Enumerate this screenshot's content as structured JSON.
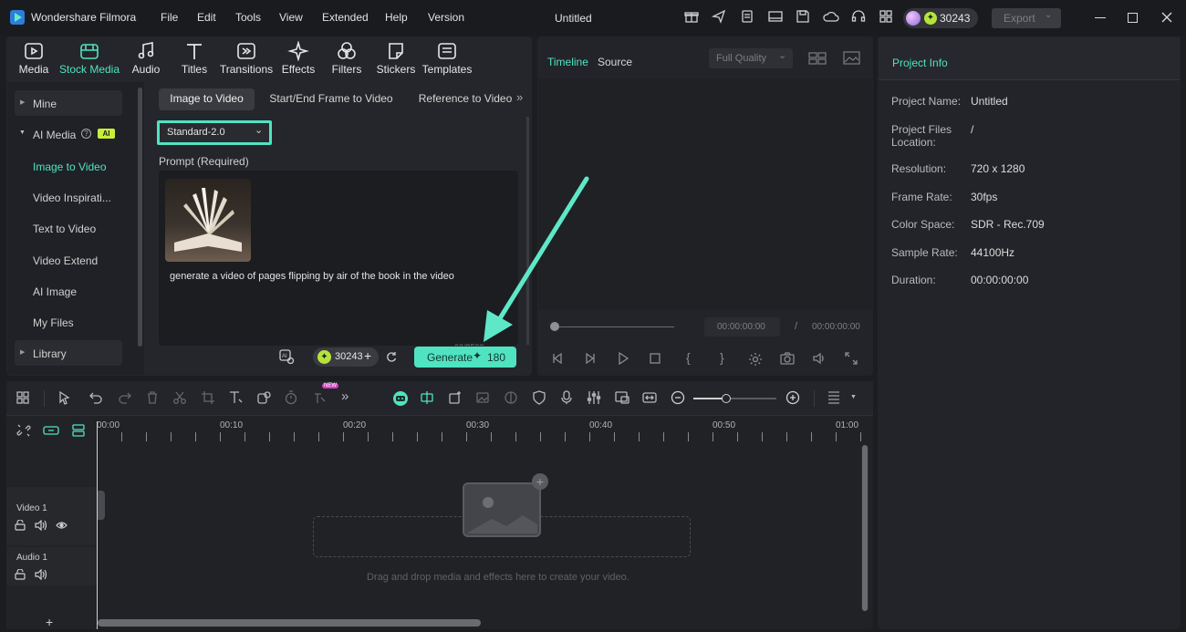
{
  "app": {
    "title": "Wondershare Filmora",
    "project_name": "Untitled"
  },
  "menu": [
    "File",
    "Edit",
    "Tools",
    "View",
    "Extended",
    "Help",
    "Version"
  ],
  "credits": "30243",
  "export_label": "Export",
  "toolbar_tabs": [
    "Media",
    "Stock Media",
    "Audio",
    "Titles",
    "Transitions",
    "Effects",
    "Filters",
    "Stickers",
    "Templates"
  ],
  "sidebar": {
    "mine": "Mine",
    "ai_media": "AI Media",
    "ai_badge": "AI",
    "items": [
      "Image to Video",
      "Video Inspirati...",
      "Text to Video",
      "Video Extend",
      "AI Image",
      "My Files"
    ],
    "library": "Library"
  },
  "subtabs": [
    "Image to Video",
    "Start/End Frame to Video",
    "Reference to Video"
  ],
  "model_select": "Standard-2.0",
  "prompt": {
    "label": "Prompt (Required)",
    "text": "generate a video of pages flipping by air of the book in the video",
    "counter": "66/2500"
  },
  "generate": {
    "credits": "30243",
    "label": "Generate",
    "cost": "180"
  },
  "preview": {
    "tabs": [
      "Timeline",
      "Source"
    ],
    "quality": "Full Quality",
    "time_current": "00:00:00:00",
    "time_sep": "/",
    "time_total": "00:00:00:00"
  },
  "project_info": {
    "title": "Project Info",
    "rows": [
      {
        "label": "Project Name:",
        "value": "Untitled"
      },
      {
        "label": "Project Files Location:",
        "value": "/"
      },
      {
        "label": "Resolution:",
        "value": "720 x 1280"
      },
      {
        "label": "Frame Rate:",
        "value": "30fps"
      },
      {
        "label": "Color Space:",
        "value": "SDR - Rec.709"
      },
      {
        "label": "Sample Rate:",
        "value": "44100Hz"
      },
      {
        "label": "Duration:",
        "value": "00:00:00:00"
      }
    ]
  },
  "timeline": {
    "new_badge": "NEW",
    "ruler": [
      "00:00",
      "00:10",
      "00:20",
      "00:30",
      "00:40",
      "00:50",
      "01:00"
    ],
    "tracks": [
      "Video 1",
      "Audio 1"
    ],
    "drop_hint": "Drag and drop media and effects here to create your video.",
    "zoom_level": 0.4
  },
  "colors": {
    "accent": "#4fe3c1",
    "bg": "#1c1d21",
    "panel": "#25262b"
  }
}
